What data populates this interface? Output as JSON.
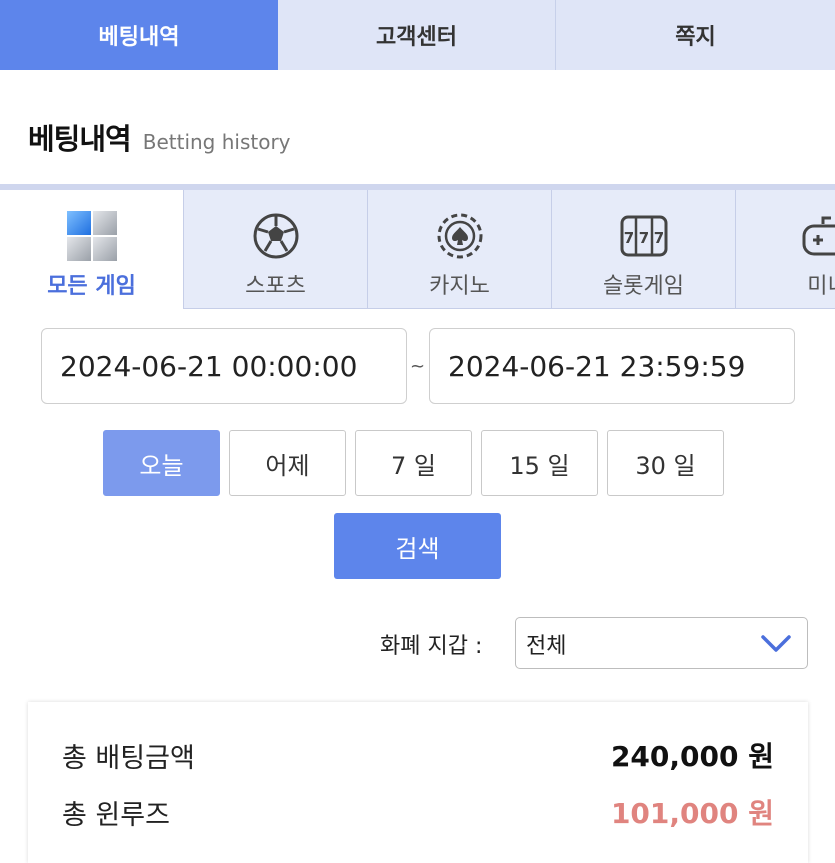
{
  "top_tabs": [
    {
      "label": "베팅내역",
      "active": true
    },
    {
      "label": "고객센터",
      "active": false
    },
    {
      "label": "쪽지",
      "active": false
    }
  ],
  "title": {
    "ko": "베팅내역",
    "en": "Betting history"
  },
  "game_tabs": [
    {
      "label": "모든 게임",
      "icon": "cubes-icon",
      "active": true
    },
    {
      "label": "스포츠",
      "icon": "soccer-ball-icon",
      "active": false
    },
    {
      "label": "카지노",
      "icon": "casino-chip-icon",
      "active": false
    },
    {
      "label": "슬롯게임",
      "icon": "slot-machine-icon",
      "active": false
    },
    {
      "label": "미니",
      "icon": "gamepad-icon",
      "active": false
    }
  ],
  "date_range": {
    "from": "2024-06-21 00:00:00",
    "separator": "~",
    "to": "2024-06-21 23:59:59"
  },
  "periods": [
    {
      "label": "오늘",
      "active": true
    },
    {
      "label": "어제",
      "active": false
    },
    {
      "label": "7 일",
      "active": false
    },
    {
      "label": "15 일",
      "active": false
    },
    {
      "label": "30 일",
      "active": false
    }
  ],
  "search_label": "검색",
  "wallet": {
    "label": "화폐 지갑 :",
    "selected": "전체"
  },
  "summary": {
    "total_bet_label": "총 배팅금액",
    "total_bet_value": "240,000 원",
    "total_win_label": "총 윈루즈",
    "total_win_value": "101,000 원"
  },
  "colors": {
    "accent": "#5d85eb",
    "tab_bg": "#dfe5f7",
    "loss_red": "#e0847f"
  }
}
